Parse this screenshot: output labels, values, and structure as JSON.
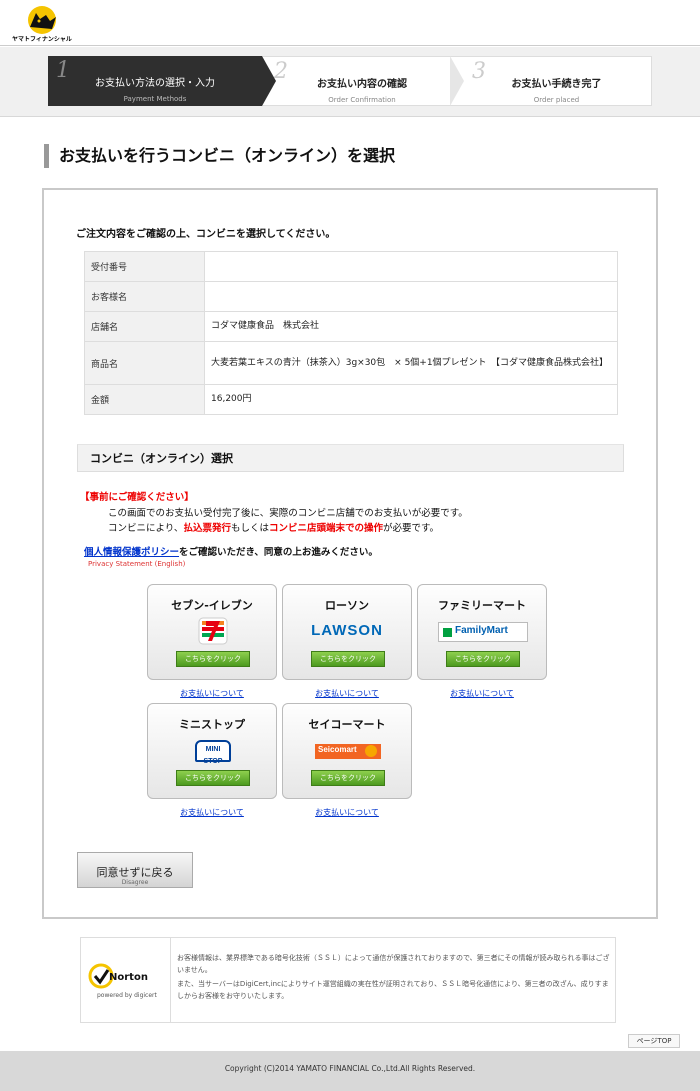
{
  "header": {
    "logo_text": "ヤマトフィナンシャル"
  },
  "steps": [
    {
      "num": "1",
      "label": "お支払い方法の選択・入力",
      "sub": "Payment Methods"
    },
    {
      "num": "2",
      "label": "お支払い内容の確認",
      "sub": "Order Confirmation"
    },
    {
      "num": "3",
      "label": "お支払い手続き完了",
      "sub": "Order placed"
    }
  ],
  "page_title": "お支払いを行うコンビニ（オンライン）を選択",
  "instruction": "ご注文内容をご確認の上、コンビニを選択してください。",
  "order": {
    "rows": [
      {
        "label": "受付番号",
        "value": ""
      },
      {
        "label": "お客様名",
        "value": ""
      },
      {
        "label": "店舗名",
        "value": "コダマ健康食品　株式会社"
      },
      {
        "label": "商品名",
        "value": "大麦若葉エキスの青汁（抹茶入）3g×30包　× 5個+1個プレゼント　【コダマ健康食品株式会社】"
      },
      {
        "label": "金額",
        "value": "16,200円"
      }
    ]
  },
  "conv_section": {
    "title": "コンビニ（オンライン）選択",
    "notice_title": "【事前にご確認ください】",
    "line1": "この画面でのお支払い受付完了後に、実際のコンビニ店舗でのお支払いが必要です。",
    "line2_a": "コンビニにより、",
    "line2_b": "払込票発行",
    "line2_c": "もしくは",
    "line2_d": "コンビニ店頭端末での操作",
    "line2_e": "が必要です。",
    "privacy_link": "個人情報保護ポリシー",
    "privacy_rest": "をご確認いただき、同意の上お進みください。",
    "privacy_en": "Privacy Statement (English)"
  },
  "stores": [
    {
      "name": "セブン-イレブン",
      "button": "こちらをクリック",
      "link": "お支払いについて"
    },
    {
      "name": "ローソン",
      "logo": "LAWSON",
      "button": "こちらをクリック",
      "link": "お支払いについて"
    },
    {
      "name": "ファミリーマート",
      "logo": "FamilyMart",
      "button": "こちらをクリック",
      "link": "お支払いについて"
    },
    {
      "name": "ミニストップ",
      "logo": "MINI STOP",
      "button": "こちらをクリック",
      "link": "お支払いについて"
    },
    {
      "name": "セイコーマート",
      "logo": "Seicomart",
      "button": "こちらをクリック",
      "link": "お支払いについて"
    }
  ],
  "back_button": {
    "label": "同意せずに戻る",
    "sub": "Disagree"
  },
  "ssl": {
    "norton": "Norton",
    "norton_sub": "powered by digicert",
    "text1": "お客様情報は、業界標準である暗号化技術（ＳＳＬ）によって通信が保護されておりますので、第三者にその情報が読み取られる事はございません。",
    "text2": "また、当サーバーはDigiCert,incによりサイト運営組織の実在性が証明されており、ＳＳＬ暗号化通信により、第三者の改ざん、成りすましからお客様をお守りいたします。"
  },
  "pagetop": "ページTOP",
  "footer": {
    "copyright": "Copyright (C)2014 YAMATO FINANCIAL Co.,Ltd.All Rights Reserved."
  },
  "colors": {
    "accent_red": "#ee0000",
    "link_blue": "#0033cc",
    "button_green": "#5aa826"
  }
}
